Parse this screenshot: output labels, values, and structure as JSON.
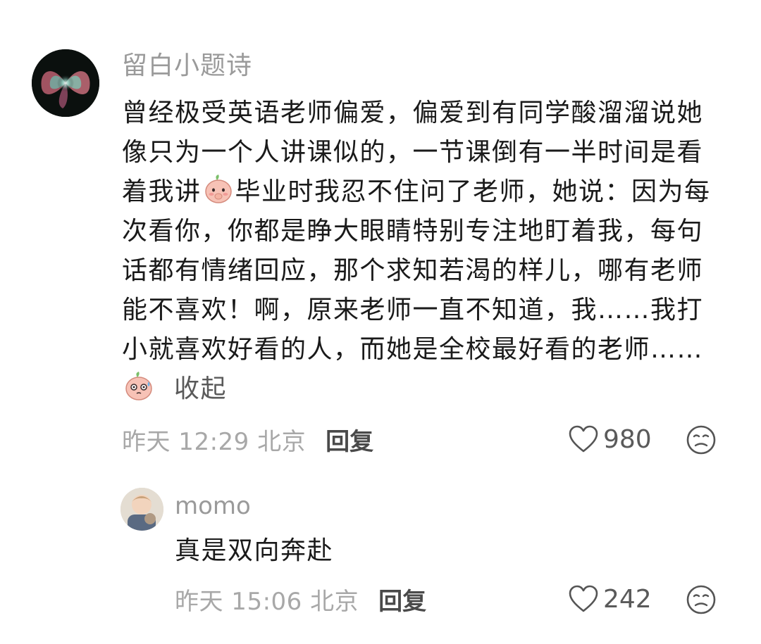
{
  "main_comment": {
    "username": "留白小题诗",
    "text_part1": "曾经极受英语老师偏爱，偏爱到有同学酸溜溜说她像只为一个人讲课似的，一节课倒有一半时间是看着我讲",
    "text_part2": "毕业时我忍不住问了老师，她说：因为每次看你，你都是睁大眼睛特别专注地盯着我，每句话都有情绪回应，那个求知若渴的样儿，哪有老师能不喜欢！啊，原来老师一直不知道，我……我打小就喜欢好看的人，而她是全校最好看的老师……",
    "emoji_1": "shy-peach-emoji",
    "emoji_2": "sweat-peach-emoji",
    "collapse_label": "收起",
    "time": "昨天 12:29 北京",
    "reply_label": "回复",
    "like_count": "980"
  },
  "reply_comment": {
    "username": "momo",
    "text": "真是双向奔赴",
    "time": "昨天 15:06 北京",
    "reply_label": "回复",
    "like_count": "242"
  },
  "icons": {
    "like": "heart-outline-icon",
    "dislike": "unhappy-face-icon"
  }
}
